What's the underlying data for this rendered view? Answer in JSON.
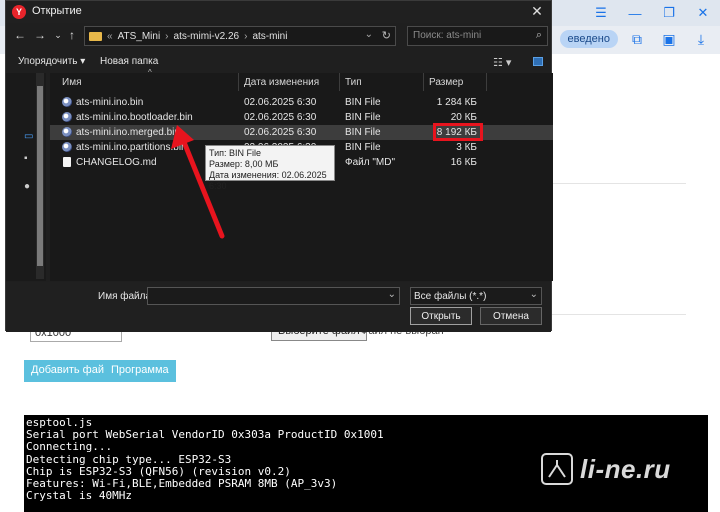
{
  "browser": {
    "toolbar_pill": "еведено"
  },
  "page": {
    "offset_value": "0x1000",
    "choose_file_label": "Выберите файл",
    "no_file_label": "Файл не выбран",
    "add_file_button": "Добавить файл",
    "program_button": "Программа",
    "console_lines": [
      "esptool.js",
      "Serial port WebSerial VendorID 0x303a ProductID 0x1001",
      "Connecting...",
      "Detecting chip type... ESP32-S3",
      "Chip is ESP32-S3 (QFN56) (revision v0.2)",
      "Features: Wi-Fi,BLE,Embedded PSRAM 8MB (AP_3v3)",
      "Crystal is 40MHz"
    ],
    "watermark": "li-ne.ru"
  },
  "dialog": {
    "title": "Открытие",
    "breadcrumb": {
      "prefix": "«",
      "parts": [
        "ATS_Mini",
        "ats-mimi-v2.26",
        "ats-mini"
      ]
    },
    "search_placeholder": "Поиск: ats-mini",
    "organize_label": "Упорядочить ▾",
    "new_folder_label": "Новая папка",
    "columns": {
      "name": "Имя",
      "date": "Дата изменения",
      "type": "Тип",
      "size": "Размер"
    },
    "files": [
      {
        "name": "ats-mini.ino.bin",
        "date": "02.06.2025 6:30",
        "type": "BIN File",
        "size": "1 284 КБ",
        "icon": "bin-file-icon"
      },
      {
        "name": "ats-mini.ino.bootloader.bin",
        "date": "02.06.2025 6:30",
        "type": "BIN File",
        "size": "20 КБ",
        "icon": "bin-file-icon"
      },
      {
        "name": "ats-mini.ino.merged.bin",
        "date": "02.06.2025 6:30",
        "type": "BIN File",
        "size": "8 192 КБ",
        "icon": "bin-file-icon"
      },
      {
        "name": "ats-mini.ino.partitions.bin",
        "date": "02.06.2025 6:30",
        "type": "BIN File",
        "size": "3 КБ",
        "icon": "bin-file-icon"
      },
      {
        "name": "CHANGELOG.md",
        "date": "",
        "type": "Файл \"MD\"",
        "size": "16 КБ",
        "icon": "md-file-icon"
      }
    ],
    "tooltip": {
      "type": "Тип: BIN File",
      "size": "Размер: 8,00 МБ",
      "modified": "Дата изменения: 02.06.2025 6:30"
    },
    "filename_label": "Имя файла:",
    "filename_value": "",
    "filter_value": "Все файлы (*.*)",
    "open_button": "Открыть",
    "cancel_button": "Отмена"
  },
  "colors": {
    "dialog_bg": "#1f1f1f",
    "highlight_red": "#e8141e",
    "button_blue": "#5bc0de",
    "console_bg": "#000000"
  }
}
